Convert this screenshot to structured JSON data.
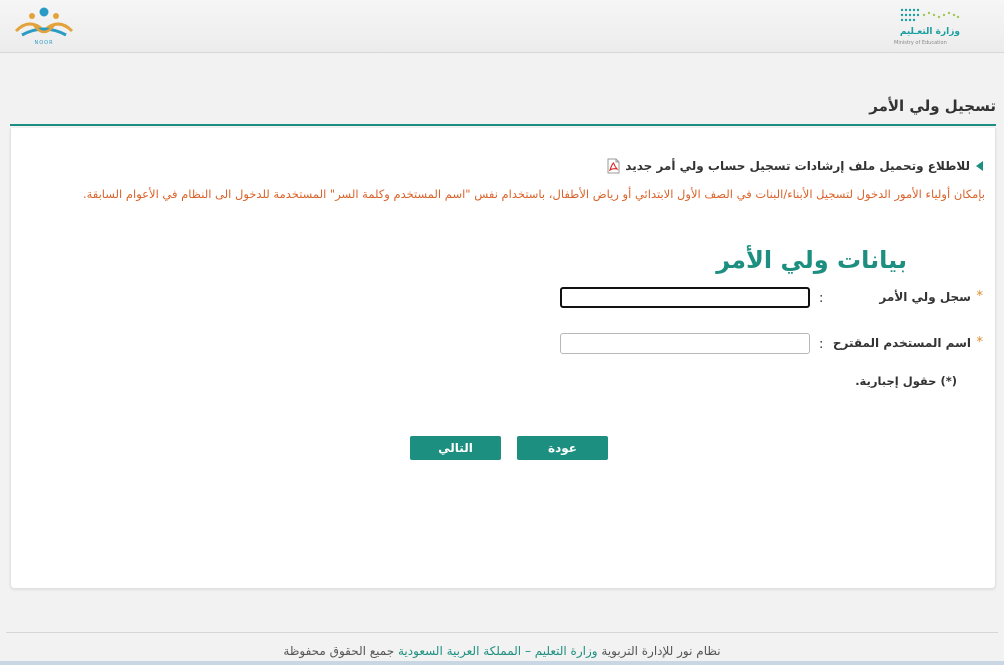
{
  "header": {
    "noor_logo_text": "NOOR",
    "moe_name": "وزارة التعـليم",
    "moe_sub": "Ministry of Education"
  },
  "page": {
    "title": "تسجيل ولي الأمر"
  },
  "guide": {
    "link_text": "للاطلاع وتحميل ملف إرشادات تسجيل حساب ولي أمر جديد"
  },
  "notice": {
    "text": "بإمكان أولياء الأمور الدخول لتسجيل الأبناء/البنات في الصف الأول الابتدائي أو رياض الأطفال، باستخدام نفس \"اسم المستخدم وكلمة السر\" المستخدمة للدخول الى النظام في الأعوام السابقة."
  },
  "form": {
    "section_title": "بيانات ولي الأمر",
    "required_mark": "*",
    "colon": ":",
    "fields": [
      {
        "label": "سجل ولي الأمر",
        "value": ""
      },
      {
        "label": "اسم المستخدم المقترح",
        "value": ""
      }
    ],
    "required_note": "(*) حقول إجبارية."
  },
  "buttons": {
    "back": "عودة",
    "next": "التالي"
  },
  "footer": {
    "prefix": "نظام نور للإدارة التربوية",
    "link": "وزارة التعليم – المملكة العربية السعودية",
    "suffix": "جميع الحقوق محفوظة"
  },
  "colors": {
    "accent": "#1d8f80",
    "notice": "#d9632b",
    "required": "#e08a2c"
  }
}
